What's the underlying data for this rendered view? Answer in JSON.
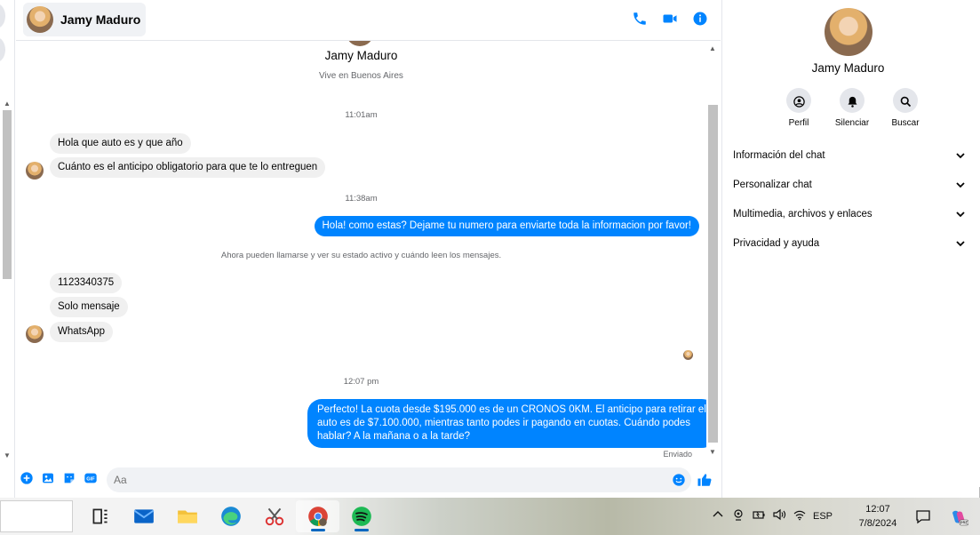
{
  "header": {
    "contact_name": "Jamy Maduro",
    "icons": [
      "phone-icon",
      "video-camera-icon",
      "info-icon"
    ]
  },
  "profile": {
    "name": "Jamy Maduro",
    "subtitle": "Vive en Buenos Aires"
  },
  "messages": {
    "time1": "11:01am",
    "in1": "Hola que auto es y que año",
    "in2": "Cuánto es el anticipo obligatorio para que te lo entreguen",
    "time2": "11:38am",
    "out1": "Hola! como estas? Dejame tu numero para enviarte toda la informacion por favor!",
    "system_notice": "Ahora pueden llamarse y ver su estado activo y cuándo leen los mensajes.",
    "in3": "1123340375",
    "in4": "Solo mensaje",
    "in5": "WhatsApp",
    "time3": "12:07 pm",
    "out2_line1": "Perfecto! La cuota desde $195.000 es de un CRONOS 0KM. El anticipo para retirar el",
    "out2_line2": "auto es de $7.100.000, mientras tanto podes ir pagando en cuotas. Cuándo podes",
    "out2_line3": "hablar? A la mañana o a la tarde?",
    "status": "Enviado"
  },
  "composer": {
    "placeholder": "Aa",
    "value": ""
  },
  "info_panel": {
    "name": "Jamy Maduro",
    "actions": {
      "profile": "Perfil",
      "mute": "Silenciar",
      "search": "Buscar"
    },
    "sections": [
      "Información del chat",
      "Personalizar chat",
      "Multimedia, archivos y enlaces",
      "Privacidad y ayuda"
    ]
  },
  "taskbar": {
    "apps": [
      "task-view",
      "mail",
      "file-explorer",
      "edge",
      "snipping-tool",
      "chrome",
      "spotify"
    ],
    "language": "ESP",
    "time": "12:07",
    "date": "7/8/2024"
  },
  "colors": {
    "accent": "#0084ff",
    "incoming_bubble": "#f0f0f0"
  }
}
